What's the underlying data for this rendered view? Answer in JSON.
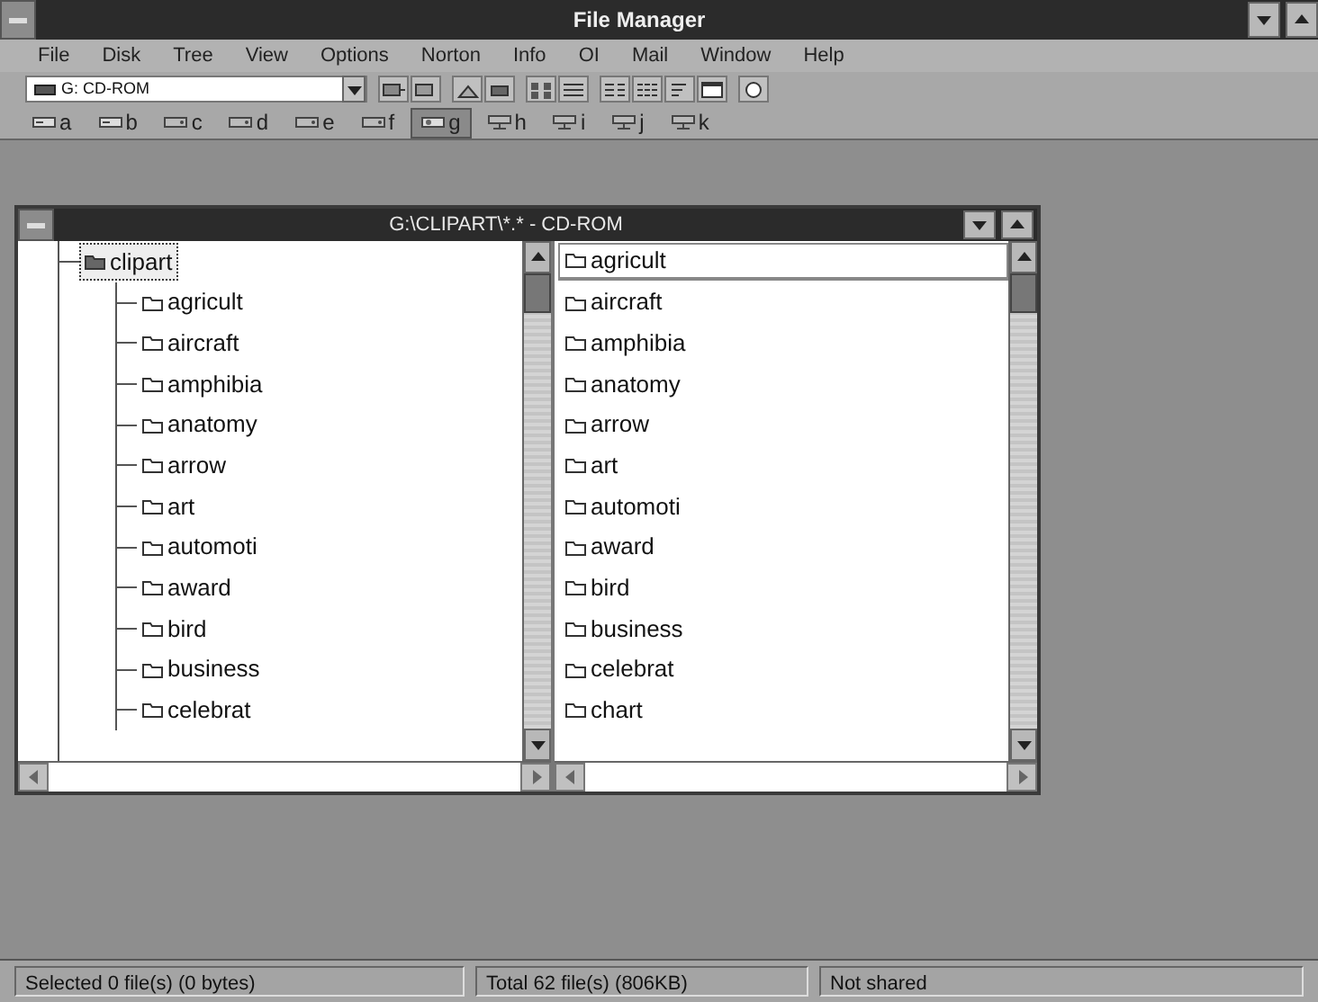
{
  "window": {
    "title": "File Manager"
  },
  "menu": [
    "File",
    "Disk",
    "Tree",
    "View",
    "Options",
    "Norton",
    "Info",
    "OI",
    "Mail",
    "Window",
    "Help"
  ],
  "toolbar": {
    "drive_selector": "G: CD-ROM"
  },
  "drives": [
    {
      "letter": "a",
      "kind": "floppy",
      "selected": false
    },
    {
      "letter": "b",
      "kind": "floppy",
      "selected": false
    },
    {
      "letter": "c",
      "kind": "hard",
      "selected": false
    },
    {
      "letter": "d",
      "kind": "hard",
      "selected": false
    },
    {
      "letter": "e",
      "kind": "hard",
      "selected": false
    },
    {
      "letter": "f",
      "kind": "hard",
      "selected": false
    },
    {
      "letter": "g",
      "kind": "cd",
      "selected": true
    },
    {
      "letter": "h",
      "kind": "network",
      "selected": false
    },
    {
      "letter": "i",
      "kind": "network",
      "selected": false
    },
    {
      "letter": "j",
      "kind": "network",
      "selected": false
    },
    {
      "letter": "k",
      "kind": "network",
      "selected": false
    }
  ],
  "child_window": {
    "title": "G:\\CLIPART\\*.* - CD-ROM",
    "tree": {
      "label": "clipart",
      "selected": true,
      "children": [
        {
          "label": "agricult"
        },
        {
          "label": "aircraft"
        },
        {
          "label": "amphibia"
        },
        {
          "label": "anatomy"
        },
        {
          "label": "arrow"
        },
        {
          "label": "art"
        },
        {
          "label": "automoti"
        },
        {
          "label": "award"
        },
        {
          "label": "bird"
        },
        {
          "label": "business"
        },
        {
          "label": "celebrat"
        }
      ]
    },
    "files": [
      {
        "name": "agricult",
        "selected": true
      },
      {
        "name": "aircraft",
        "selected": false
      },
      {
        "name": "amphibia",
        "selected": false
      },
      {
        "name": "anatomy",
        "selected": false
      },
      {
        "name": "arrow",
        "selected": false
      },
      {
        "name": "art",
        "selected": false
      },
      {
        "name": "automoti",
        "selected": false
      },
      {
        "name": "award",
        "selected": false
      },
      {
        "name": "bird",
        "selected": false
      },
      {
        "name": "business",
        "selected": false
      },
      {
        "name": "celebrat",
        "selected": false
      },
      {
        "name": "chart",
        "selected": false
      }
    ]
  },
  "status_bar": [
    "Selected 0 file(s) (0 bytes)",
    "Total 62 file(s) (806KB)",
    "Not shared"
  ]
}
